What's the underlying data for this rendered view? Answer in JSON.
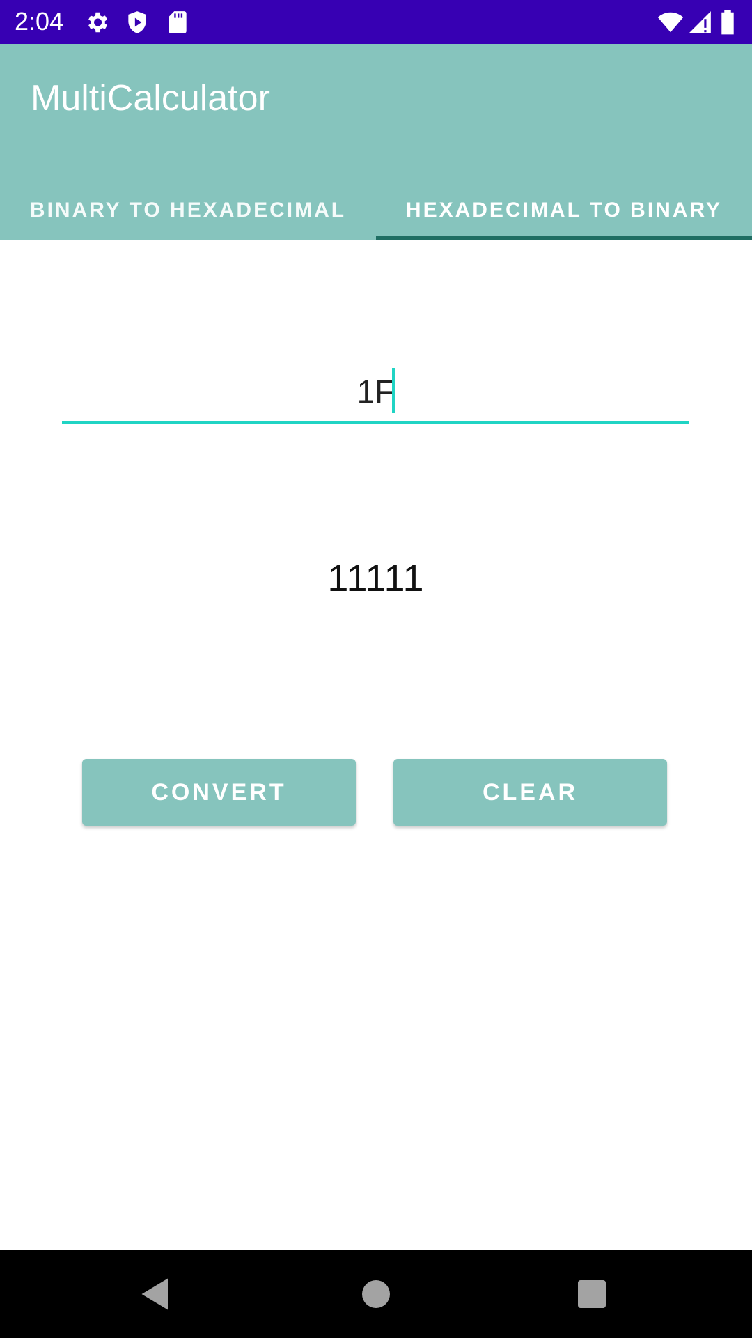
{
  "status_bar": {
    "time": "2:04",
    "icons": [
      "gear-icon",
      "shield-play-icon",
      "sd-card-icon",
      "wifi-icon",
      "signal-icon",
      "battery-icon"
    ],
    "background": "#3700b3"
  },
  "app_bar": {
    "title": "MultiCalculator",
    "background": "#86c4bd",
    "tabs": [
      {
        "label": "BINARY TO HEXADECIMAL",
        "active": false
      },
      {
        "label": "HEXADECIMAL TO BINARY",
        "active": true
      }
    ],
    "indicator_color": "#1f6e63"
  },
  "converter": {
    "input_value": "1F",
    "result": "11111",
    "accent": "#20d4c4"
  },
  "buttons": {
    "convert_label": "CONVERT",
    "clear_label": "CLEAR"
  },
  "nav_bar": {
    "icons": [
      "back-icon",
      "home-icon",
      "recents-icon"
    ]
  }
}
